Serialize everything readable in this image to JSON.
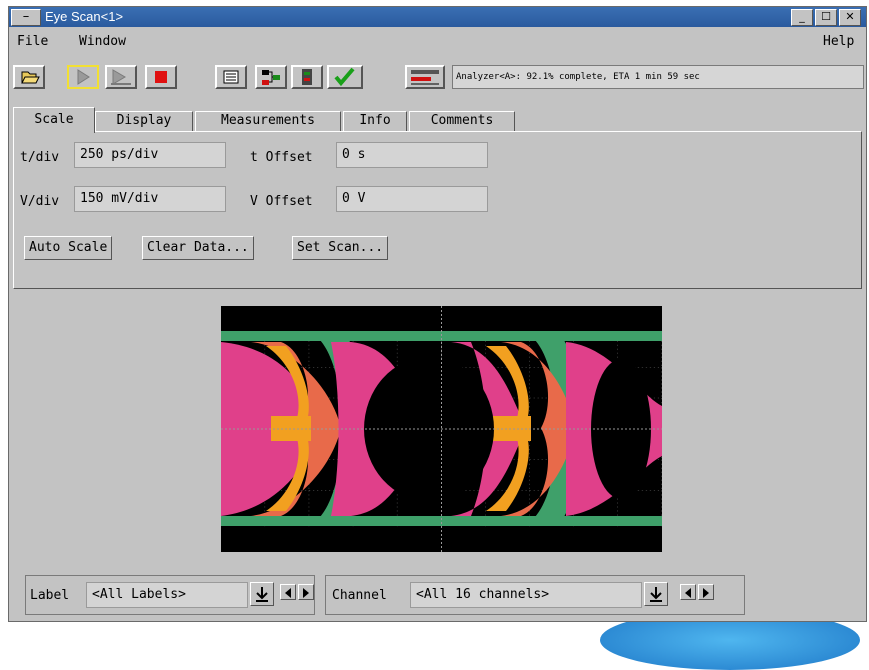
{
  "window": {
    "title": "Eye Scan<1>",
    "sysmenu_glyph": "–",
    "controls": {
      "minimize": "_",
      "maximize": "☐",
      "close": "✕"
    }
  },
  "menubar": {
    "file": "File",
    "window": "Window",
    "help": "Help"
  },
  "toolbar": {
    "buttons": [
      "folder-open-icon",
      "run-icon",
      "run-repetitive-icon",
      "stop-icon",
      "listing-icon",
      "hierarchy-icon",
      "module-icon",
      "checkmark-icon",
      "probe-icon"
    ],
    "status": "Analyzer<A>:  92.1% complete, ETA 1 min 59 sec"
  },
  "tabs": [
    "Scale",
    "Display",
    "Measurements",
    "Info",
    "Comments"
  ],
  "scale": {
    "tdiv_label": "t/div",
    "tdiv_value": "250 ps/div",
    "toffset_label": "t Offset",
    "toffset_value": "0 s",
    "vdiv_label": "V/div",
    "vdiv_value": "150 mV/div",
    "voffset_label": "V Offset",
    "voffset_value": "0 V"
  },
  "actions": {
    "auto_scale": "Auto Scale",
    "clear_data": "Clear Data...",
    "set_scan": "Set Scan..."
  },
  "bottom": {
    "label_label": "Label",
    "label_value": "<All Labels>",
    "channel_label": "Channel",
    "channel_value": "<All 16 channels>"
  },
  "colors": {
    "titlebar": "#2f64a8",
    "stop": "#e01010",
    "check": "#19a019",
    "eye_green": "#3fa06a",
    "eye_pink": "#e0408a",
    "eye_orange": "#f2a020"
  }
}
